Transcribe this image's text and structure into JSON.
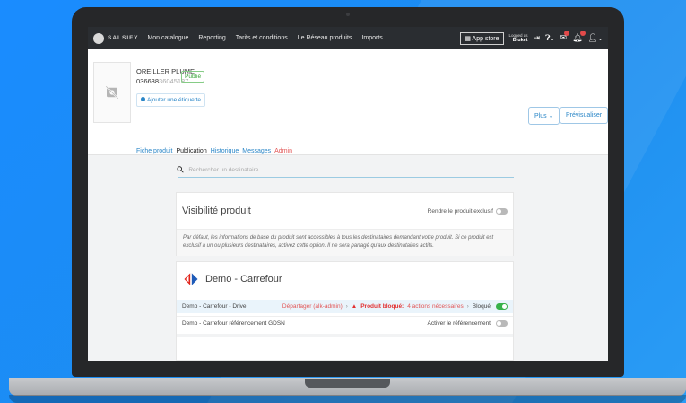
{
  "topbar": {
    "brand": "SALSIFY",
    "nav": [
      "Mon catalogue",
      "Reporting",
      "Tarifs et conditions",
      "Le Réseau produits",
      "Imports"
    ],
    "app_store": "App store",
    "logged_as": "Logged as",
    "user": "Bluket"
  },
  "product": {
    "name": "OREILLER PLUME",
    "code_prefix": "036638",
    "code_suffix": "36045187",
    "status": "Publié",
    "add_tag": "Ajouter une étiquette",
    "tabs": [
      {
        "label": "Fiche produit"
      },
      {
        "label": "Publication"
      },
      {
        "label": "Historique"
      },
      {
        "label": "Messages"
      },
      {
        "label": "Admin"
      }
    ],
    "plus_button": "Plus",
    "preview_button": "Prévisualiser"
  },
  "search": {
    "placeholder": "Rechercher un destinataire"
  },
  "visibility": {
    "title": "Visibilité produit",
    "toggle_label": "Rendre le produit exclusif",
    "description_line1": "Par défaut, les informations de base du produit sont accessibles à tous les destinataires demandant votre produit. Si ce produit est",
    "description_line2": "exclusif à un ou plusieurs destinataires, activez cette option. Il ne sera partagé qu'aux destinataires actifs."
  },
  "carrefour": {
    "title": "Demo - Carrefour",
    "rows": [
      {
        "name": "Demo - Carrefour - Drive",
        "depart": "Départager (alk-admin)",
        "blocked": "Produit bloqué:",
        "actions": "4 actions nécessaires",
        "state": "Bloqué"
      },
      {
        "name": "Demo - Carrefour référencement GDSN",
        "action": "Activer le référencement"
      }
    ]
  },
  "colors": {
    "accent": "#2a86c7",
    "success": "#38b24a",
    "danger": "#e25555",
    "topbar": "#2a2d31"
  }
}
